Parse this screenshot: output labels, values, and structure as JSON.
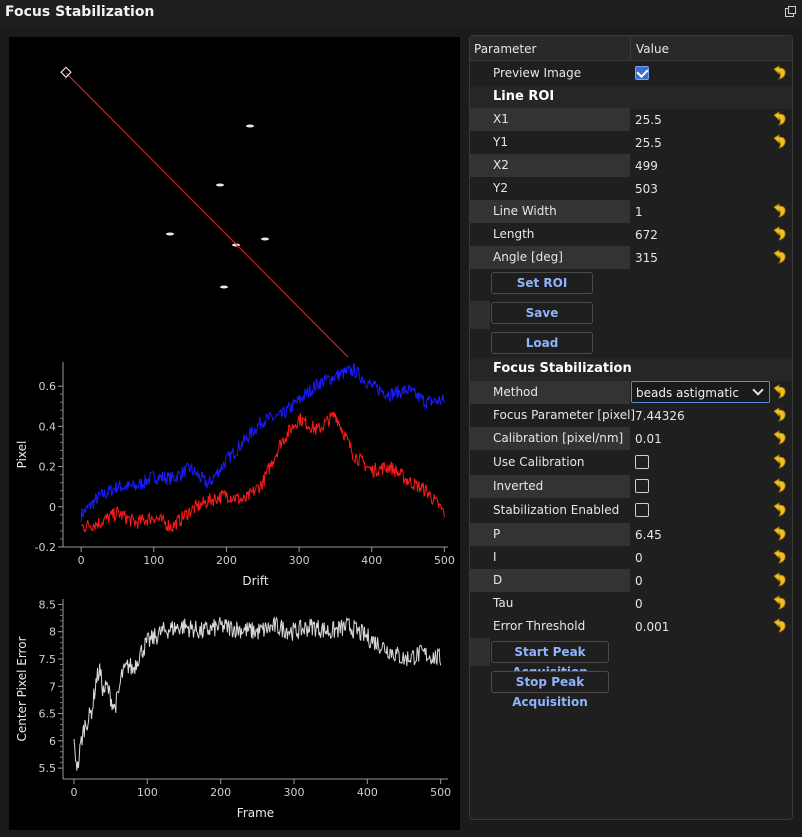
{
  "window": {
    "title": "Focus Stabilization"
  },
  "table": {
    "col_param": "Parameter",
    "col_value": "Value"
  },
  "params": {
    "preview_image": {
      "label": "Preview Image",
      "checked": true
    },
    "line_roi": "Line ROI",
    "x1": {
      "label": "X1",
      "value": "25.5"
    },
    "y1": {
      "label": "Y1",
      "value": "25.5"
    },
    "x2": {
      "label": "X2",
      "value": "499"
    },
    "y2": {
      "label": "Y2",
      "value": "503"
    },
    "line_width": {
      "label": "Line Width",
      "value": "1"
    },
    "length": {
      "label": "Length",
      "value": "672"
    },
    "angle": {
      "label": "Angle [deg]",
      "value": "315"
    },
    "set_roi": "Set ROI",
    "save": "Save",
    "load": "Load",
    "focus_stab": "Focus Stabilization",
    "method": {
      "label": "Method",
      "value": "beads astigmatic"
    },
    "focus_param": {
      "label": "Focus Parameter [pixel]",
      "value": "7.44326"
    },
    "calibration": {
      "label": "Calibration [pixel/nm]",
      "value": "0.01"
    },
    "use_calibration": {
      "label": "Use Calibration",
      "checked": false
    },
    "inverted": {
      "label": "Inverted",
      "checked": false
    },
    "stab_enabled": {
      "label": "Stabilization Enabled",
      "checked": false
    },
    "p": {
      "label": "P",
      "value": "6.45"
    },
    "i": {
      "label": "I",
      "value": "0"
    },
    "d": {
      "label": "D",
      "value": "0"
    },
    "tau": {
      "label": "Tau",
      "value": "0"
    },
    "error_threshold": {
      "label": "Error Threshold",
      "value": "0.001"
    },
    "start_peak": "Start Peak Acquisition",
    "stop_peak": "Stop Peak Acquisition"
  },
  "colors": {
    "accent": "#3d6fd1",
    "roi_line": "#ff2020",
    "series_blue": "#1a1aff",
    "series_red": "#ff1a1a",
    "series_white": "#d8d8d8"
  },
  "chart_data": [
    {
      "type": "line",
      "xlabel": "Drift",
      "ylabel": "Pixel",
      "xlim": [
        -25,
        505
      ],
      "ylim": [
        -0.2,
        0.72
      ],
      "xticks": [
        0,
        100,
        200,
        300,
        400,
        500
      ],
      "yticks": [
        -0.2,
        0,
        0.2,
        0.4,
        0.6
      ],
      "ytick_labels": [
        "-0.2",
        "0",
        "0.2",
        "0.4",
        "0.6"
      ],
      "series": [
        {
          "color": "#1a1aff",
          "x": [
            0,
            25,
            50,
            75,
            100,
            125,
            150,
            175,
            200,
            225,
            250,
            275,
            300,
            325,
            350,
            375,
            400,
            425,
            450,
            475,
            500
          ],
          "values": [
            -0.04,
            0.05,
            0.1,
            0.1,
            0.15,
            0.14,
            0.19,
            0.11,
            0.23,
            0.33,
            0.43,
            0.45,
            0.53,
            0.61,
            0.65,
            0.68,
            0.6,
            0.56,
            0.58,
            0.52,
            0.53
          ]
        },
        {
          "color": "#ff1a1a",
          "x": [
            0,
            25,
            50,
            75,
            100,
            125,
            150,
            175,
            200,
            225,
            250,
            275,
            300,
            325,
            350,
            375,
            400,
            425,
            450,
            475,
            500
          ],
          "values": [
            -0.1,
            -0.08,
            -0.03,
            -0.08,
            -0.05,
            -0.1,
            -0.02,
            0.03,
            0.06,
            0.03,
            0.12,
            0.32,
            0.44,
            0.38,
            0.46,
            0.26,
            0.18,
            0.2,
            0.13,
            0.08,
            -0.03
          ]
        }
      ]
    },
    {
      "type": "line",
      "xlabel": "Frame",
      "ylabel": "Center Pixel Error",
      "xlim": [
        -15,
        510
      ],
      "ylim": [
        5.3,
        8.6
      ],
      "xticks": [
        0,
        100,
        200,
        300,
        400,
        500
      ],
      "yticks": [
        5.5,
        6,
        6.5,
        7,
        7.5,
        8,
        8.5
      ],
      "ytick_labels": [
        "5.5",
        "6",
        "6.5",
        "7",
        "7.5",
        "8",
        "8.5"
      ],
      "series": [
        {
          "color": "#d8d8d8",
          "x": [
            0,
            5,
            10,
            15,
            20,
            25,
            30,
            35,
            40,
            45,
            50,
            55,
            60,
            65,
            70,
            75,
            80,
            90,
            100,
            110,
            120,
            130,
            150,
            175,
            200,
            225,
            250,
            275,
            300,
            325,
            350,
            375,
            400,
            425,
            450,
            475,
            500
          ],
          "values": [
            5.9,
            5.5,
            6.0,
            6.3,
            6.4,
            6.6,
            7.1,
            7.3,
            6.9,
            7.0,
            6.8,
            6.6,
            6.8,
            7.2,
            7.3,
            7.4,
            7.3,
            7.6,
            7.8,
            7.9,
            8.0,
            8.05,
            8.1,
            8.0,
            8.1,
            8.05,
            8.0,
            8.1,
            8.0,
            8.1,
            8.0,
            8.1,
            7.9,
            7.7,
            7.5,
            7.6,
            7.5
          ]
        }
      ]
    }
  ]
}
